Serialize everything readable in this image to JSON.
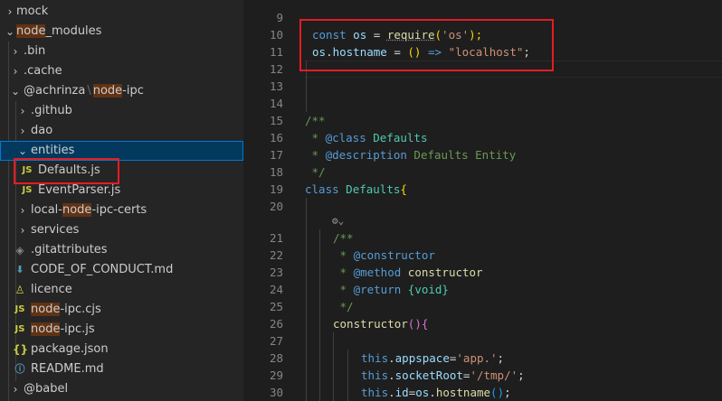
{
  "explorer": {
    "items": [
      {
        "chevron": "›",
        "label": "mock"
      },
      {
        "chevron": "⌄",
        "label_hl": "node",
        "label_rest": "_modules"
      },
      {
        "chevron": "›",
        "label": ".bin"
      },
      {
        "chevron": "›",
        "label": ".cache"
      },
      {
        "chevron": "⌄",
        "label_a": "@achrinza",
        "sep": "\\",
        "label_hl": "node",
        "label_rest": "-ipc"
      },
      {
        "chevron": "›",
        "label": ".github"
      },
      {
        "chevron": "›",
        "label": "dao"
      },
      {
        "chevron": "⌄",
        "label": "entities"
      },
      {
        "icon": "JS",
        "label": "Defaults.js"
      },
      {
        "icon": "JS",
        "label": "EventParser.js"
      },
      {
        "chevron": "›",
        "label_a": "local-",
        "label_hl": "node",
        "label_rest": "-ipc-certs"
      },
      {
        "chevron": "›",
        "label": "services"
      },
      {
        "icon": "◈",
        "label": ".gitattributes"
      },
      {
        "icon": "⬇",
        "label": "CODE_OF_CONDUCT.md"
      },
      {
        "icon": "♙",
        "label": "licence"
      },
      {
        "icon": "JS",
        "label_hl": "node",
        "label_rest": "-ipc.cjs"
      },
      {
        "icon": "JS",
        "label_hl": "node",
        "label_rest": "-ipc.js"
      },
      {
        "icon": "{}",
        "label": "package.json"
      },
      {
        "icon": "ⓘ",
        "label": "README.md"
      },
      {
        "chevron": "›",
        "label": "@babel"
      }
    ]
  },
  "editor": {
    "line_numbers": [
      "9",
      "10",
      "11",
      "12",
      "13",
      "14",
      "15",
      "16",
      "17",
      "18",
      "19",
      "20",
      "21",
      "22",
      "23",
      "24",
      "25",
      "26",
      "27",
      "28",
      "29",
      "30"
    ],
    "codelens_icon": "⚙⌄",
    "lines": {
      "l10": {
        "kw": "const",
        "var": "os",
        "eq": "=",
        "fn": "require",
        "open": "(",
        "str": "'os'",
        "close": ");"
      },
      "l11": {
        "var1": "os",
        "dot": ".",
        "var2": "hostname",
        "eq": "=",
        "parens": "()",
        "arrow": "=>",
        "str": "\"localhost\"",
        "end": ";"
      },
      "l15": "/**",
      "l16": {
        "star": " * ",
        "tag": "@class",
        "text": " Defaults"
      },
      "l17": {
        "star": " * ",
        "tag": "@description",
        "text": " Defaults Entity"
      },
      "l18": " */",
      "l19": {
        "kw": "class",
        "cls": "Defaults",
        "brace": "{"
      },
      "l21": "/**",
      "l22": {
        "star": " * ",
        "tag": "@constructor"
      },
      "l23": {
        "star": " * ",
        "tag": "@method",
        "text": " constructor"
      },
      "l24": {
        "star": " * ",
        "tag": "@return",
        "text": " {void}"
      },
      "l25": " */",
      "l26": {
        "fn": "constructor",
        "parens": "()",
        "brace": "{"
      },
      "l28": {
        "kw": "this",
        "dot": ".",
        "var": "appspace",
        "eq": "=",
        "str": "'app.'",
        "end": ";"
      },
      "l29": {
        "kw": "this",
        "dot": ".",
        "var": "socketRoot",
        "eq": "=",
        "str": "'/tmp/'",
        "end": ";"
      },
      "l30": {
        "kw": "this",
        "dot": ".",
        "var": "id",
        "eq": "=",
        "var2": "os",
        "dot2": ".",
        "fn": "hostname",
        "parens": "()",
        "end": ";"
      }
    }
  },
  "colors": {
    "highlight_box": "#e51c23",
    "selection": "#04395e"
  }
}
